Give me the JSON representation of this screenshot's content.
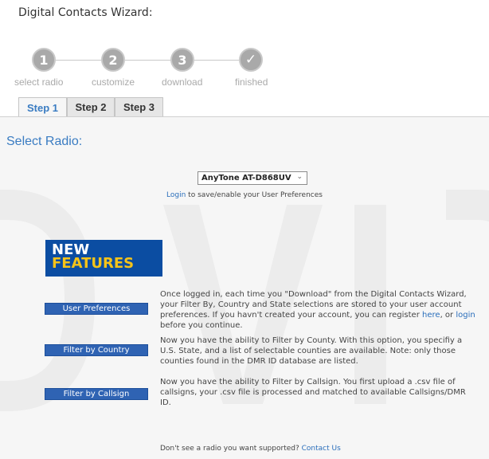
{
  "page_title": "Digital Contacts Wizard:",
  "wizard": {
    "steps": [
      {
        "number": "1",
        "label": "select radio"
      },
      {
        "number": "2",
        "label": "customize"
      },
      {
        "number": "3",
        "label": "download"
      },
      {
        "number": "✓",
        "label": "finished"
      }
    ]
  },
  "tabs": [
    {
      "label": "Step 1",
      "active": true
    },
    {
      "label": "Step 2",
      "active": false
    },
    {
      "label": "Step 3",
      "active": false
    }
  ],
  "panel": {
    "title": "Select Radio:",
    "radio_select": {
      "value": "AnyTone AT-D868UV"
    },
    "login_link": "Login",
    "login_suffix": " to save/enable your User Preferences",
    "new_features": {
      "line1": "NEW",
      "line2": "FEATURES"
    },
    "features": [
      {
        "button": "User Preferences",
        "text_a": "Once logged in, each time you \"Download\" from the Digital Contacts Wizard, your Filter By, Country and State selections are stored to your user account preferences. If you havn't created your account, you can register ",
        "link_here": "here",
        "text_b": ", or ",
        "link_login": "login",
        "text_c": " before you continue."
      },
      {
        "button": "Filter by Country",
        "text": "Now you have the ability to Filter by County. With this option, you specifiy a U.S. State, and a list of selectable counties are available. Note: only those counties found in the DMR ID database are listed."
      },
      {
        "button": "Filter by Callsign",
        "text": "Now you have the ability to Filter by Callsign. You first upload a .csv file of callsigns, your .csv file is processed and matched to available Callsigns/DMR ID."
      }
    ],
    "contact_prefix": "Don't see a radio you want supported? ",
    "contact_link": "Contact Us"
  },
  "colors": {
    "accent": "#3a7cc2",
    "button_blue": "#2f63b3",
    "badge_blue": "#0b4da2",
    "badge_yellow": "#f5c319",
    "step_gray": "#a9a9a9"
  }
}
